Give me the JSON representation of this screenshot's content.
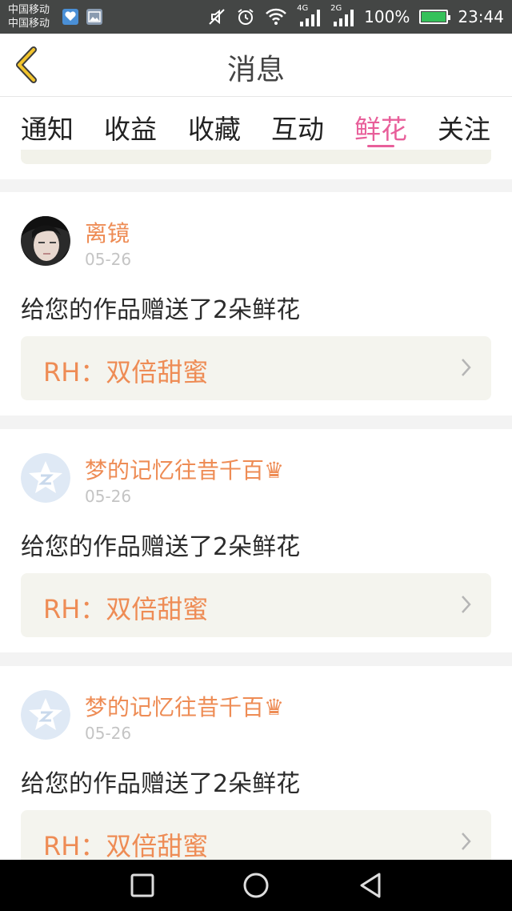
{
  "status_bar": {
    "carrier_1": "中国移动",
    "carrier_2": "中国移动",
    "network_1": "4G",
    "network_2": "2G",
    "battery": "100%",
    "time": "23:44",
    "icons": [
      "app-notification-icon",
      "gallery-notification-icon",
      "mute-icon",
      "alarm-icon",
      "wifi-icon",
      "signal-icon",
      "battery-icon"
    ]
  },
  "header": {
    "title": "消息",
    "back_icon": "back-chevron-icon"
  },
  "tabs": [
    {
      "label": "通知"
    },
    {
      "label": "收益"
    },
    {
      "label": "收藏"
    },
    {
      "label": "互动"
    },
    {
      "label": "鲜花",
      "active": true
    },
    {
      "label": "关注"
    }
  ],
  "colors": {
    "accent_pink": "#e85f9a",
    "name_orange": "#ee8c55",
    "card_bg": "#f4f4ee"
  },
  "messages": [
    {
      "sender": "离镜",
      "date": "05-26",
      "text": "给您的作品赠送了2朵鲜花",
      "work": "RH：双倍甜蜜",
      "avatar": "photo-avatar"
    },
    {
      "sender": "梦的记忆往昔千百♛",
      "date": "05-26",
      "text": "给您的作品赠送了2朵鲜花",
      "work": "RH：双倍甜蜜",
      "avatar": "default-star-avatar"
    },
    {
      "sender": "梦的记忆往昔千百♛",
      "date": "05-26",
      "text": "给您的作品赠送了2朵鲜花",
      "work": "RH：双倍甜蜜",
      "avatar": "default-star-avatar"
    }
  ],
  "nav_bar": {
    "icons": [
      "recents-icon",
      "home-icon",
      "back-triangle-icon"
    ]
  }
}
